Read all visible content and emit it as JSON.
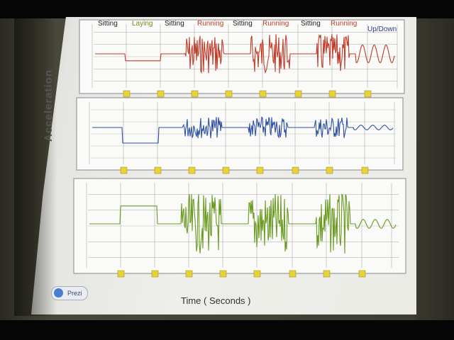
{
  "slide": {
    "y_axis_title": "Acceleration",
    "x_axis_title": "Time ( Seconds )",
    "prezi_badge": "Prezi"
  },
  "activities": [
    {
      "label": "Sitting",
      "color": "#222222"
    },
    {
      "label": "Laying",
      "color": "#7a8a1a"
    },
    {
      "label": "Sitting",
      "color": "#222222"
    },
    {
      "label": "Running",
      "color": "#c23b2a"
    },
    {
      "label": "Sitting",
      "color": "#222222"
    },
    {
      "label": "Running",
      "color": "#c23b2a"
    },
    {
      "label": "Sitting",
      "color": "#222222"
    },
    {
      "label": "Running",
      "color": "#c23b2a"
    },
    {
      "label": "Up/Down",
      "color": "#2d3d8a"
    }
  ],
  "panels": [
    {
      "axis": "x",
      "color": "#c23b2a"
    },
    {
      "axis": "y",
      "color": "#3050a8"
    },
    {
      "axis": "z",
      "color": "#6a9a20"
    }
  ],
  "colors": {
    "grid": "#b8b8b8",
    "marker": "#e8d23a",
    "frame": "#9a9aa0"
  }
}
